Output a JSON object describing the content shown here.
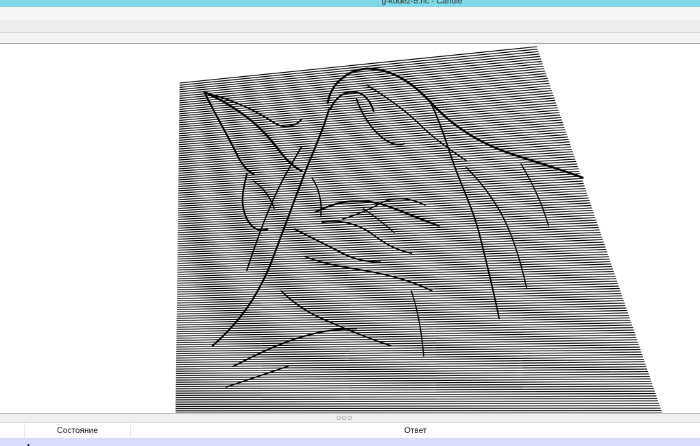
{
  "window": {
    "title": "g-kodez-5.nc - Candle",
    "titlebar_color": "#7fd8e6"
  },
  "viewport": {
    "background": "#ffffff",
    "toolpath_color": "#000000",
    "description_icon": "heightmap-toolpath-engraving"
  },
  "console": {
    "columns": [
      {
        "label": ""
      },
      {
        "label": "Состояние"
      },
      {
        "label": "Ответ"
      }
    ],
    "selected_row_color": "#d9dcff"
  }
}
